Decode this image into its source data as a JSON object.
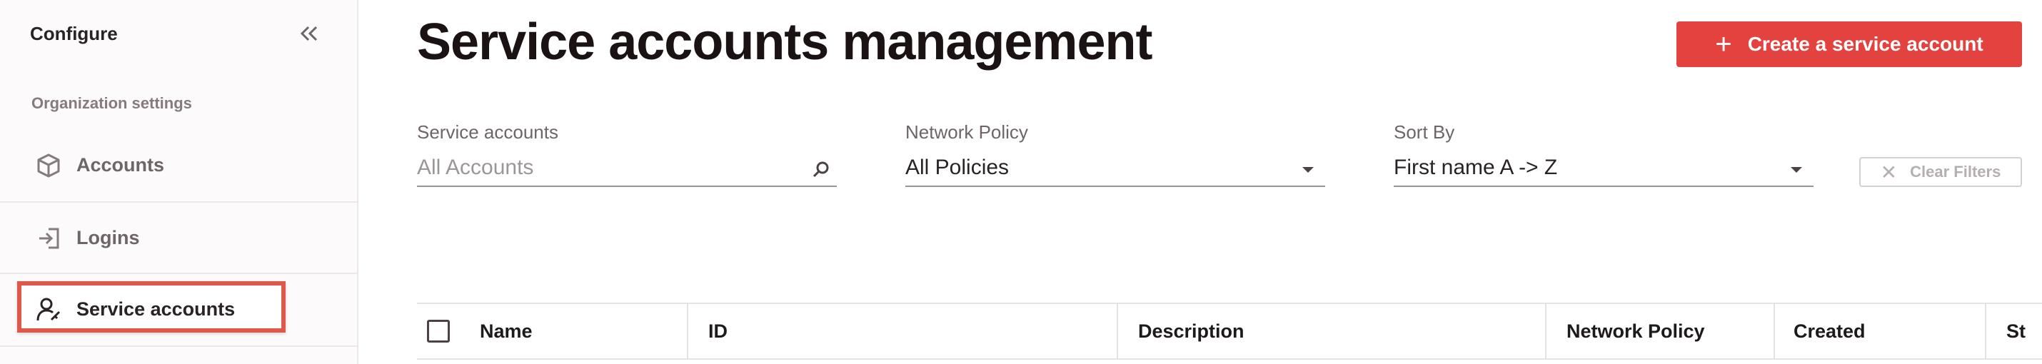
{
  "sidebar": {
    "title": "Configure",
    "section_label": "Organization settings",
    "items": [
      {
        "label": "Accounts",
        "icon": "cube-icon"
      },
      {
        "label": "Logins",
        "icon": "login-icon"
      },
      {
        "label": "Service accounts",
        "icon": "service-account-icon"
      }
    ]
  },
  "header": {
    "title": "Service accounts management",
    "create_button_label": "Create a service account"
  },
  "filters": {
    "service_accounts": {
      "label": "Service accounts",
      "placeholder": "All Accounts"
    },
    "network_policy": {
      "label": "Network Policy",
      "value": "All Policies"
    },
    "sort_by": {
      "label": "Sort By",
      "value": "First name A -> Z"
    },
    "clear_label": "Clear Filters"
  },
  "table": {
    "columns": [
      "Name",
      "ID",
      "Description",
      "Network Policy",
      "Created",
      "St"
    ]
  },
  "colors": {
    "accent": "#e4423e",
    "highlight_border": "#e0584a"
  }
}
